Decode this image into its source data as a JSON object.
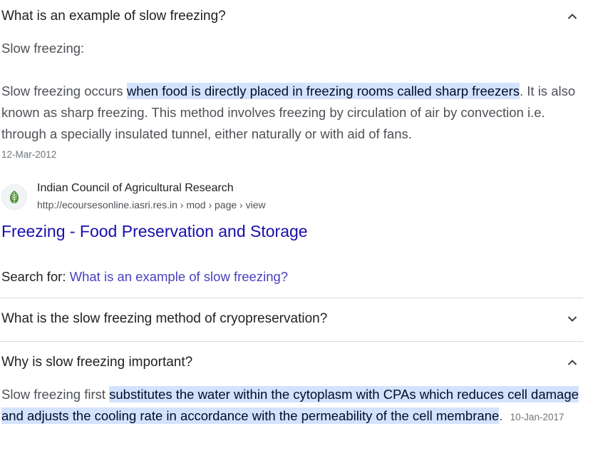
{
  "faq": [
    {
      "question": "What is an example of slow freezing?",
      "expanded": true,
      "heading": "Slow freezing:",
      "answer_plain_1": "Slow freezing occurs ",
      "answer_highlight": "when food is directly placed in freezing rooms called sharp freezers",
      "answer_plain_2": ". It is also known as sharp freezing. This method involves freezing by circulation of air by convection i.e. through a specially insulated tunnel, either naturally or with aid of fans.",
      "date": "12-Mar-2012",
      "source": {
        "site_name": "Indian Council of Agricultural Research",
        "url": "http://ecoursesonline.iasri.res.in › mod › page › view",
        "title": "Freezing - Food Preservation and Storage"
      },
      "search_for_label": "Search for: ",
      "search_for_query": "What is an example of slow freezing?"
    },
    {
      "question": "What is the slow freezing method of cryopreservation?",
      "expanded": false
    },
    {
      "question": "Why is slow freezing important?",
      "expanded": true,
      "answer_plain_1": "Slow freezing first ",
      "answer_highlight": "substitutes the water within the cytoplasm with CPAs which reduces cell damage and adjusts the cooling rate in accordance with the permeability of the cell membrane",
      "answer_plain_2": ".",
      "date": "10-Jan-2017"
    }
  ],
  "icons": {
    "expanded": "chevron-up-icon",
    "collapsed": "chevron-down-icon",
    "favicon": "icar-logo-icon"
  },
  "colors": {
    "highlight": "#d3e3fd",
    "link": "#1a0dab",
    "divider": "#dadce0"
  }
}
